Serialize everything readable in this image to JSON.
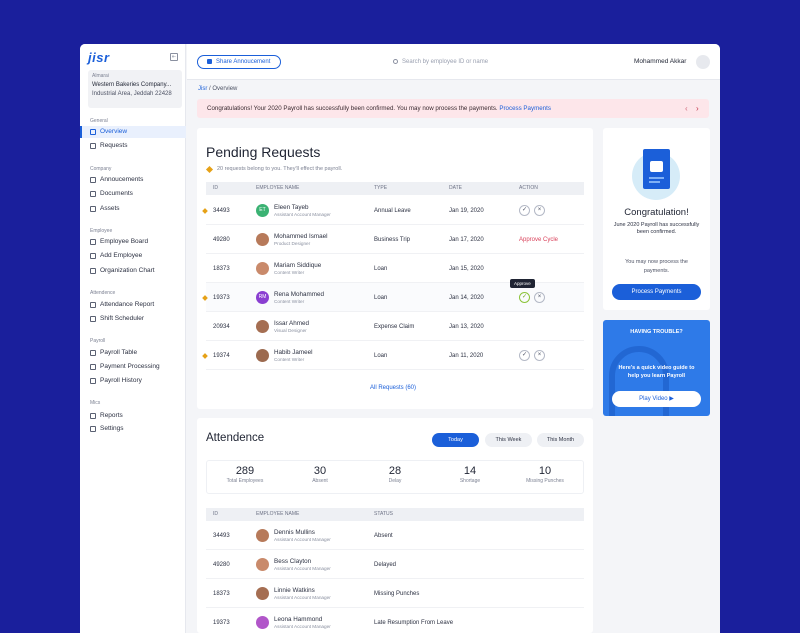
{
  "app": {
    "logo": "jisr",
    "collapse_glyph": "⇤"
  },
  "company": {
    "label": "Almarai",
    "name": "Western Bakeries Company...",
    "address": "Industrial Area, Jeddah 22428"
  },
  "nav": {
    "general": "General",
    "overview": "Overview",
    "requests": "Requests",
    "company": "Company",
    "announcements": "Annoucements",
    "documents": "Documents",
    "assets": "Assets",
    "employee": "Employee",
    "employee_board": "Employee Board",
    "add_employee": "Add Employee",
    "org_chart": "Organization Chart",
    "attendence": "Attendence",
    "attendance_report": "Attendance Report",
    "shift_scheduler": "Shift Scheduler",
    "payroll": "Payroll",
    "payroll_table": "Payroll Table",
    "payment_processing": "Payment Processing",
    "payroll_history": "Payroll History",
    "misc": "Mics",
    "reports": "Reports",
    "settings": "Settings"
  },
  "topbar": {
    "share_label": "Share Annoucement",
    "search_placeholder": "Search by employee ID or name",
    "user_name": "Mohammed Akkar"
  },
  "breadcrumb": {
    "home": "Jisr",
    "separator": " / ",
    "current": "Overview"
  },
  "alert": {
    "text": "Congratulations! Your 2020 Payroll has successfully been confirmed. You may now process the payments. ",
    "link": "Process Payments",
    "prev": "‹",
    "next": "›"
  },
  "pending": {
    "title": "Pending Requests",
    "subtitle": "20 requests belong to you. They'll effect the payroll.",
    "headers": {
      "id": "ID",
      "name": "EMPLOYEE NAME",
      "type": "TYPE",
      "date": "DATE",
      "action": "ACTION"
    },
    "approve_glyph": "✓",
    "reject_glyph": "×",
    "rows": [
      {
        "id": "34493",
        "name": "Eleen Tayeb",
        "role": "Assistant Account Manager",
        "type": "Annual Leave",
        "date": "Jan 19, 2020",
        "initials": "ET",
        "avatar_color": "#3bb273",
        "cycle": ""
      },
      {
        "id": "49280",
        "name": "Mohammed Ismael",
        "role": "Product Designer",
        "type": "Business Trip",
        "date": "Jan 17, 2020",
        "initials": "",
        "avatar_color": "#b77a5a",
        "cycle": "Approve Cycle"
      },
      {
        "id": "18373",
        "name": "Mariam Siddique",
        "role": "Content Writer",
        "type": "Loan",
        "date": "Jan 15, 2020",
        "initials": "",
        "avatar_color": "#c98a6b",
        "cycle": ""
      },
      {
        "id": "19373",
        "name": "Rena Mohammed",
        "role": "Content Writer",
        "type": "Loan",
        "date": "Jan 14, 2020",
        "initials": "RM",
        "avatar_color": "#8a3fd1",
        "cycle": ""
      },
      {
        "id": "20934",
        "name": "Issar Ahmed",
        "role": "Visual Designer",
        "type": "Expense Claim",
        "date": "Jan 13, 2020",
        "initials": "",
        "avatar_color": "#a56e52",
        "cycle": ""
      },
      {
        "id": "19374",
        "name": "Habib Jameel",
        "role": "Content Writer",
        "type": "Loan",
        "date": "Jan 11, 2020",
        "initials": "",
        "avatar_color": "#9c6a4f",
        "cycle": ""
      }
    ],
    "tooltip": "Approve",
    "all_requests": "All Requests (60)"
  },
  "congrats": {
    "title": "Congratulation!",
    "text": "June 2020 Payroll has successfully been confirmed.",
    "text2": "You may now process the payments.",
    "button": "Process Payments"
  },
  "trouble": {
    "title": "HAVING TROUBLE?",
    "text": "Here's a quick video guide to help you learn Payroll",
    "button": "Play Video ▶"
  },
  "attendance": {
    "title": "Attendence",
    "tabs": [
      "Today",
      "This Week",
      "This Month"
    ],
    "stats": [
      {
        "value": "289",
        "label": "Total Employees"
      },
      {
        "value": "30",
        "label": "Absent"
      },
      {
        "value": "28",
        "label": "Delay"
      },
      {
        "value": "14",
        "label": "Shortage"
      },
      {
        "value": "10",
        "label": "Missing Punches"
      }
    ],
    "headers": {
      "id": "ID",
      "name": "EMPLOYEE NAME",
      "status": "STATUS"
    },
    "rows": [
      {
        "id": "34493",
        "name": "Dennis Mullins",
        "role": "Assistant Account Manager",
        "status": "Absent",
        "avatar_color": "#b77a5a"
      },
      {
        "id": "49280",
        "name": "Bess Clayton",
        "role": "Assistant Account Manager",
        "status": "Delayed",
        "avatar_color": "#c98a6b"
      },
      {
        "id": "18373",
        "name": "Linnie Watkins",
        "role": "Assistant Account Manager",
        "status": "Missing Punches",
        "avatar_color": "#a56e52"
      },
      {
        "id": "19373",
        "name": "Leona Hammond",
        "role": "Assistant Account Manager",
        "status": "Late Resumption From Leave",
        "avatar_color": "#b156c9"
      }
    ]
  },
  "colors": {
    "accent": "#1b5fd9",
    "background": "#1a1f9c",
    "alert_bg": "#fde6ea",
    "pending_dot": "#e6a117",
    "danger": "#d9415a"
  }
}
